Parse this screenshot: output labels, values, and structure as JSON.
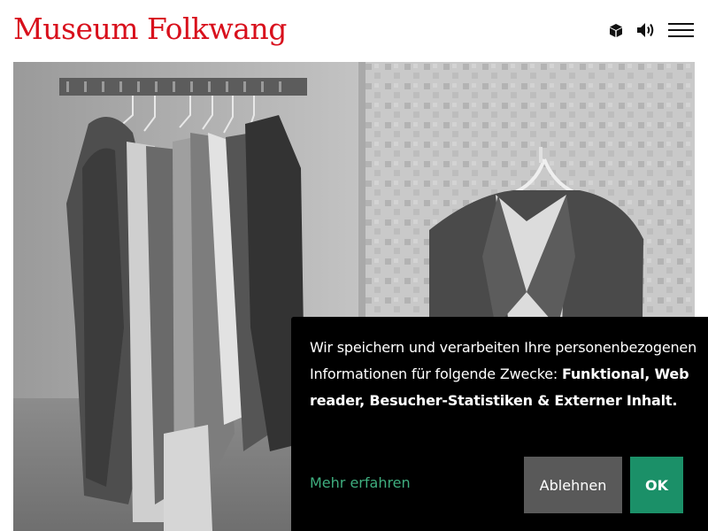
{
  "header": {
    "logo_text": "Museum Folkwang",
    "icons": [
      "cube-icon",
      "speaker-icon",
      "hamburger-menu-icon"
    ],
    "brand_color": "#d8101c"
  },
  "hero": {
    "image_description_icon": "photo"
  },
  "cookie_banner": {
    "text_intro": "Wir speichern und verarbeiten Ihre personenbezogenen Informationen für folgende Zwecke: ",
    "text_purposes": "Funktional, Web reader, Besucher-Statistiken & Externer Inhalt",
    "text_end": ".",
    "more_label": "Mehr erfahren",
    "decline_label": "Ablehnen",
    "ok_label": "OK",
    "colors": {
      "background": "#000000",
      "link": "#3fae7f",
      "decline": "#595959",
      "ok": "#1b9068"
    }
  }
}
